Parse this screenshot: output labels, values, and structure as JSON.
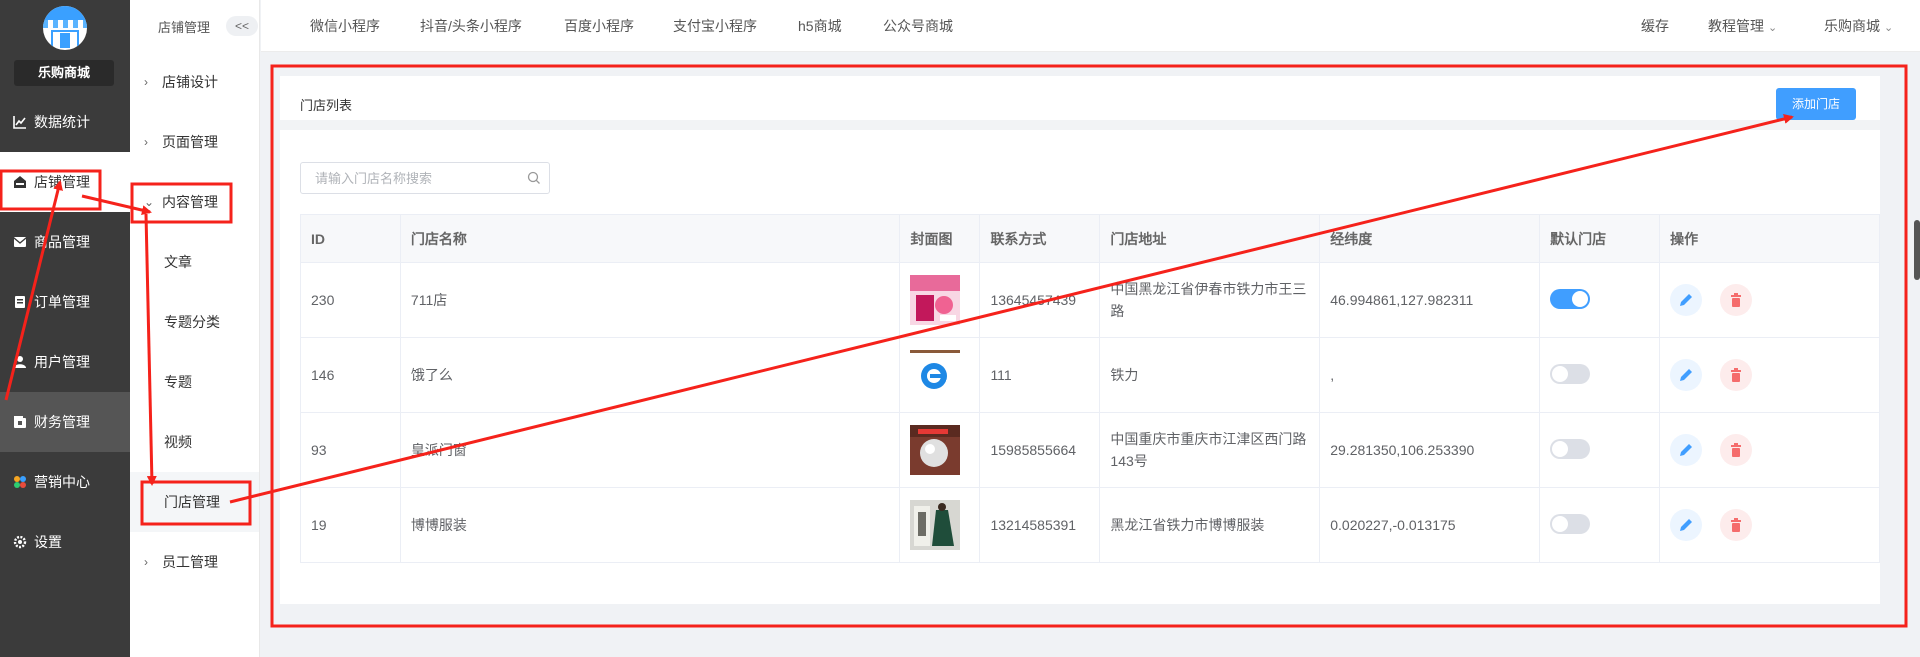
{
  "brand": {
    "name": "乐购商城"
  },
  "sidebar": {
    "items": [
      {
        "label": "数据统计",
        "icon": "chart-icon"
      },
      {
        "label": "店铺管理",
        "icon": "store-icon"
      },
      {
        "label": "商品管理",
        "icon": "goods-icon"
      },
      {
        "label": "订单管理",
        "icon": "order-icon"
      },
      {
        "label": "用户管理",
        "icon": "user-icon"
      },
      {
        "label": "财务管理",
        "icon": "wallet-icon"
      },
      {
        "label": "营销中心",
        "icon": "marketing-icon"
      },
      {
        "label": "设置",
        "icon": "gear-icon"
      }
    ]
  },
  "subnav": {
    "title": "店铺管理",
    "collapse": "<<",
    "items": [
      {
        "label": "店铺设计"
      },
      {
        "label": "页面管理"
      },
      {
        "label": "内容管理"
      }
    ],
    "children": [
      {
        "label": "文章"
      },
      {
        "label": "专题分类"
      },
      {
        "label": "专题"
      },
      {
        "label": "视频"
      },
      {
        "label": "门店管理"
      }
    ],
    "last": {
      "label": "员工管理"
    }
  },
  "topbar": {
    "tabs": [
      "微信小程序",
      "抖音/头条小程序",
      "百度小程序",
      "支付宝小程序",
      "h5商城",
      "公众号商城"
    ],
    "cache": "缓存",
    "tutorial": "教程管理",
    "mall": "乐购商城"
  },
  "panel": {
    "title": "门店列表",
    "add_label": "添加门店",
    "search_placeholder": "请输入门店名称搜索"
  },
  "table": {
    "headers": [
      "ID",
      "门店名称",
      "封面图",
      "联系方式",
      "门店地址",
      "经纬度",
      "默认门店",
      "操作"
    ],
    "rows": [
      {
        "id": "230",
        "name": "711店",
        "phone": "13645457439",
        "address": "中国黑龙江省伊春市铁力市王三路",
        "latlng": "46.994861,127.982311",
        "default": true
      },
      {
        "id": "146",
        "name": "饿了么",
        "phone": "111",
        "address": "铁力",
        "latlng": ",",
        "default": false
      },
      {
        "id": "93",
        "name": "皇派门窗",
        "phone": "15985855664",
        "address": "中国重庆市重庆市江津区西门路143号",
        "latlng": "29.281350,106.253390",
        "default": false
      },
      {
        "id": "19",
        "name": "博博服装",
        "phone": "13214585391",
        "address": "黑龙江省铁力市博博服装",
        "latlng": "0.020227,-0.013175",
        "default": false
      }
    ]
  },
  "colors": {
    "primary": "#409eff",
    "sidebar_bg": "#3b3b3b",
    "annotation": "#f5221b",
    "danger": "#f56c6c"
  }
}
